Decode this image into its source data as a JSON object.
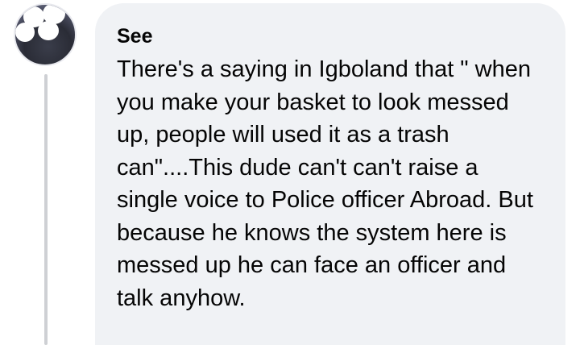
{
  "comment": {
    "author_visible": "See",
    "text": "There's a saying in Igboland that \" when you make your basket to look messed up, people will used it as a trash can\"....This dude can't can't raise a single voice to Police officer Abroad. But because he knows the system here is messed up he can face an officer and talk anyhow."
  },
  "colors": {
    "bubble_background": "#f0f2f5",
    "thread_line": "#ced0d4",
    "text": "#050505"
  }
}
